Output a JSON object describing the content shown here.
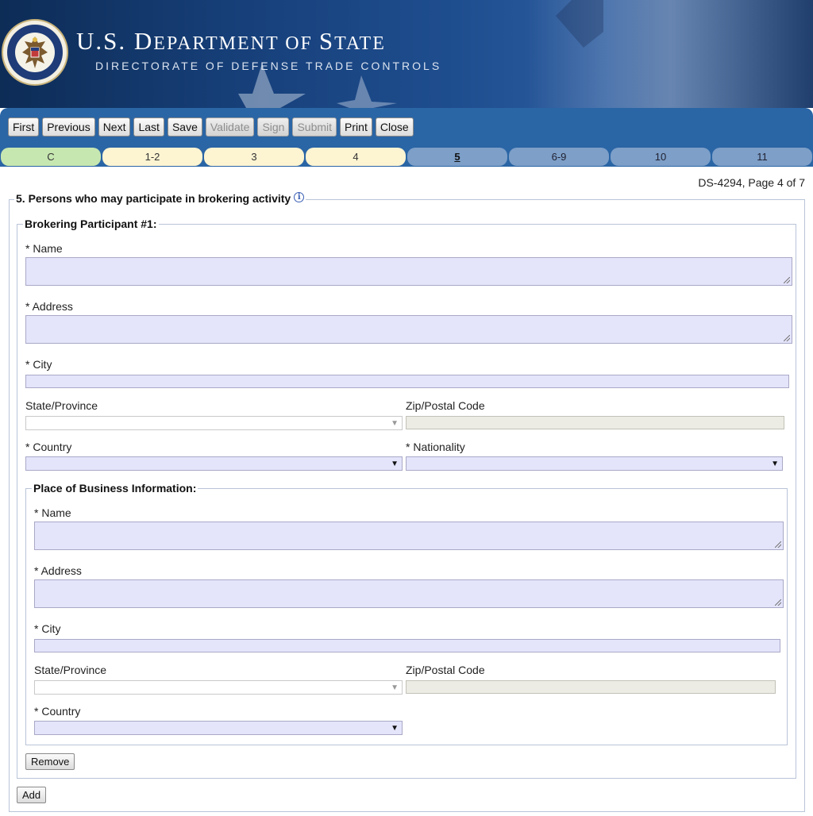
{
  "header": {
    "title_us": "U.S. ",
    "title_dept_first": "D",
    "title_dept_rest": "EPARTMENT",
    "title_of": " OF ",
    "title_state_first": "S",
    "title_state_rest": "TATE",
    "subtitle": "DIRECTORATE OF DEFENSE TRADE CONTROLS",
    "seal_text_top": "DEPARTMENT OF STATE",
    "seal_text_bottom": "UNITED STATES OF AMERICA"
  },
  "toolbar": {
    "buttons": [
      {
        "label": "First",
        "enabled": true
      },
      {
        "label": "Previous",
        "enabled": true
      },
      {
        "label": "Next",
        "enabled": true
      },
      {
        "label": "Last",
        "enabled": true
      },
      {
        "label": "Save",
        "enabled": true
      },
      {
        "label": "Validate",
        "enabled": false
      },
      {
        "label": "Sign",
        "enabled": false
      },
      {
        "label": "Submit",
        "enabled": false
      },
      {
        "label": "Print",
        "enabled": true
      },
      {
        "label": "Close",
        "enabled": true
      }
    ]
  },
  "tabs": [
    {
      "label": "C",
      "state": "c"
    },
    {
      "label": "1-2",
      "state": "done"
    },
    {
      "label": "3",
      "state": "done"
    },
    {
      "label": "4",
      "state": "done"
    },
    {
      "label": "5",
      "state": "active"
    },
    {
      "label": "6-9",
      "state": "todo"
    },
    {
      "label": "10",
      "state": "todo"
    },
    {
      "label": "11",
      "state": "todo"
    }
  ],
  "page_label": "DS-4294, Page 4 of 7",
  "section": {
    "title": "5. Persons who may participate in brokering activity",
    "info_glyph": "i",
    "participant": {
      "legend": "Brokering Participant #1:",
      "name_label": "* Name",
      "address_label": "* Address",
      "city_label": "* City",
      "state_label": "State/Province",
      "zip_label": "Zip/Postal Code",
      "country_label": "* Country",
      "nationality_label": "* Nationality",
      "business": {
        "legend": "Place of Business Information:",
        "name_label": "* Name",
        "address_label": "* Address",
        "city_label": "* City",
        "state_label": "State/Province",
        "zip_label": "Zip/Postal Code",
        "country_label": "* Country"
      },
      "remove_label": "Remove"
    },
    "add_label": "Add"
  },
  "colors": {
    "toolbar_blue": "#2a65a5",
    "field_fill": "#e4e4fb",
    "tab_complete": "#fdf4d2",
    "tab_cover": "#c7e7b1",
    "tab_pending": "#7d9fc8"
  },
  "icons": {
    "dropdown": "triangle-down"
  }
}
